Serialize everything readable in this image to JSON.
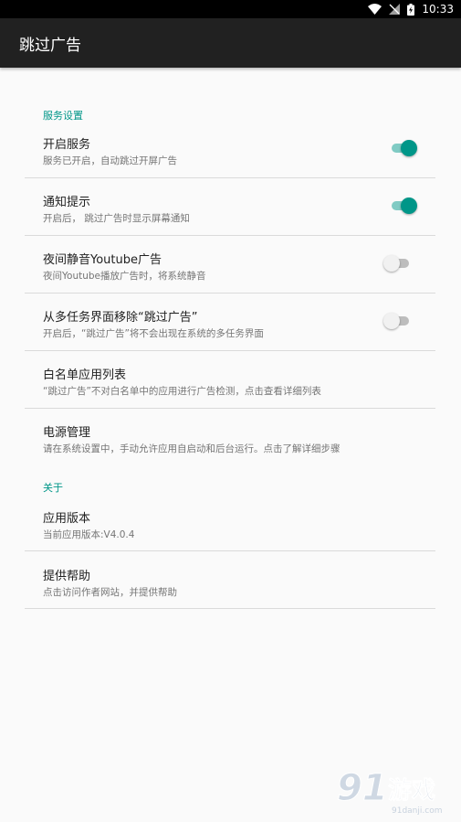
{
  "status_bar": {
    "time": "10:33"
  },
  "app_bar": {
    "title": "跳过广告"
  },
  "sections": {
    "service": {
      "header": "服务设置"
    },
    "about": {
      "header": "关于"
    }
  },
  "prefs": {
    "enable_service": {
      "title": "开启服务",
      "summary": "服务已开启，自动跳过开屏广告",
      "enabled": true
    },
    "notification": {
      "title": "通知提示",
      "summary": "开启后， 跳过广告时显示屏幕通知",
      "enabled": true
    },
    "mute_youtube": {
      "title": "夜间静音Youtube广告",
      "summary": "夜间Youtube播放广告时，将系统静音",
      "enabled": false
    },
    "hide_recents": {
      "title": "从多任务界面移除“跳过广告”",
      "summary": "开启后，“跳过广告”将不会出现在系统的多任务界面",
      "enabled": false
    },
    "whitelist": {
      "title": "白名单应用列表",
      "summary": "“跳过广告”不对白名单中的应用进行广告检测，点击查看详细列表"
    },
    "power": {
      "title": "电源管理",
      "summary": "请在系统设置中，手动允许应用自启动和后台运行。点击了解详细步骤"
    },
    "version": {
      "title": "应用版本",
      "summary": "当前应用版本:V4.0.4"
    },
    "help": {
      "title": "提供帮助",
      "summary": "点击访问作者网站，并提供帮助"
    }
  },
  "watermark": {
    "text": "91游戏",
    "subtext": "91danji.com"
  },
  "colors": {
    "accent": "#009688",
    "app_bar": "#212121",
    "background": "#fafafa"
  }
}
